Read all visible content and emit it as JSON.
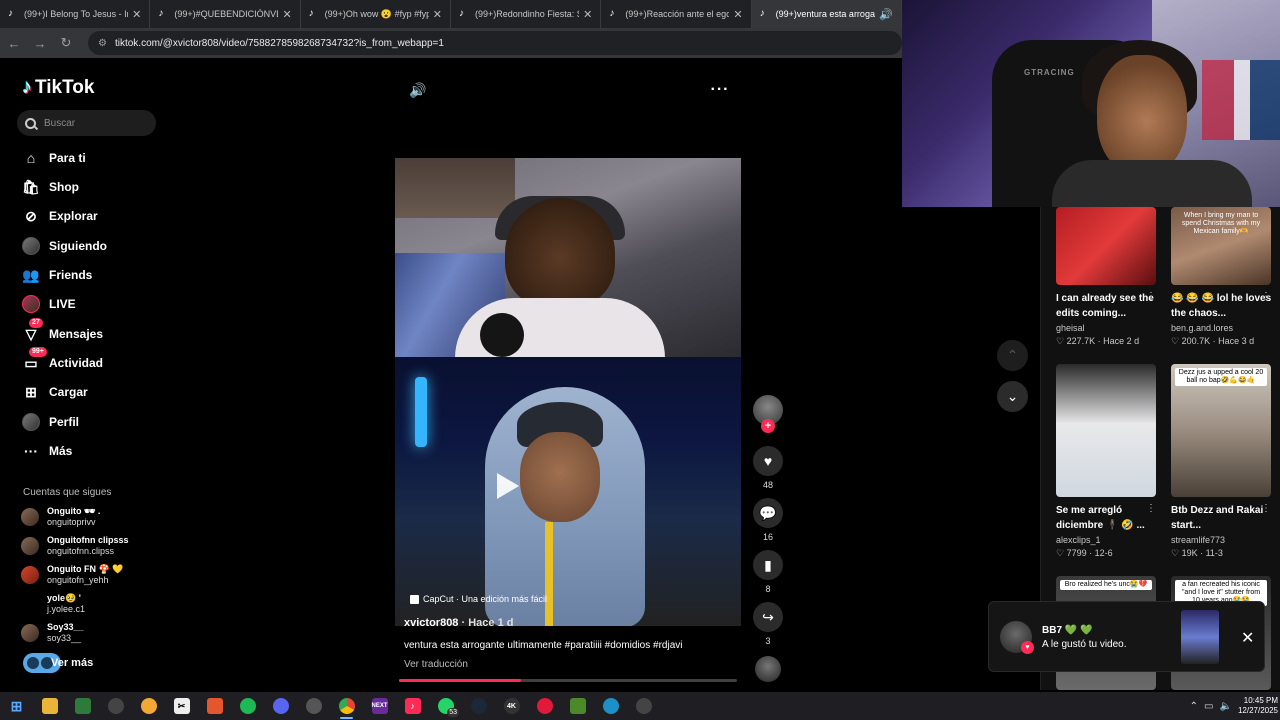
{
  "browser": {
    "tabs": [
      {
        "title": "(99+)I Belong To Jesus - Insp",
        "active": false
      },
      {
        "title": "(99+)#QUEBENDICIÓNVE | ti",
        "active": false
      },
      {
        "title": "(99+)Oh wow 😮 #fyp #fyp",
        "active": false
      },
      {
        "title": "(99+)Redondinho Fiesta: Sie",
        "active": false
      },
      {
        "title": "(99+)Reacción ante el ego en",
        "active": false
      },
      {
        "title": "(99+)ventura esta arroga",
        "active": true
      }
    ],
    "url": "tiktok.com/@xvictor808/video/7588278598268734732?is_from_webapp=1"
  },
  "sidebar": {
    "logo": "TikTok",
    "search_placeholder": "Buscar",
    "nav": [
      {
        "label": "Para ti",
        "icon": "home-icon"
      },
      {
        "label": "Shop",
        "icon": "shop-icon"
      },
      {
        "label": "Explorar",
        "icon": "compass-icon"
      },
      {
        "label": "Siguiendo",
        "icon": "following-avatar-icon"
      },
      {
        "label": "Friends",
        "icon": "friends-icon"
      },
      {
        "label": "LIVE",
        "icon": "live-icon"
      },
      {
        "label": "Mensajes",
        "icon": "messages-icon",
        "badge": "27"
      },
      {
        "label": "Actividad",
        "icon": "activity-icon",
        "badge": "99+"
      },
      {
        "label": "Cargar",
        "icon": "upload-icon"
      },
      {
        "label": "Perfil",
        "icon": "profile-icon"
      },
      {
        "label": "Más",
        "icon": "more-icon"
      }
    ],
    "following_title": "Cuentas que sigues",
    "following": [
      {
        "name": "Onguito 🕶 .",
        "user": "onguitoprivv"
      },
      {
        "name": "Onguitofnn clipsss",
        "user": "onguitofnn.clipss"
      },
      {
        "name": "Onguito FN 🍄 💛",
        "user": "onguitofn_yehh"
      },
      {
        "name": "yole🥹 '",
        "user": "j.yolee.c1"
      },
      {
        "name": "Soy33__",
        "user": "soy33__"
      }
    ],
    "see_more": "Ver más"
  },
  "player": {
    "capcut_label": "CapCut · Una edición más fácil",
    "author": "xvictor808",
    "time_ago": " · Hace 1 d",
    "caption": "ventura esta arrogante ultimamente #paratiiii #domidios #rdjavi",
    "translate": "Ver traducción",
    "progress": 0.36,
    "likes": "48",
    "comments": "16",
    "saves": "8",
    "shares": "3"
  },
  "recommended": [
    {
      "overlay": "",
      "title": "I can already see the edits coming...",
      "user": "gheisal",
      "likes": "227.7K",
      "age": "Hace 2 d"
    },
    {
      "overlay": "When I bring my man to spend Christmas with my Mexican family🫶",
      "title": "😂 😂 😂 lol he loves the chaos...",
      "user": "ben.g.and.lores",
      "likes": "200.7K",
      "age": "Hace 3 d"
    },
    {
      "overlay": "",
      "title": "Se me arregló diciembre 🕴 🤣 ...",
      "user": "alexclips_1",
      "likes": "7799",
      "age": "12-6"
    },
    {
      "overlay": "Dezz jus a upped a cool 20 ball no bap🤣💪😂🤙",
      "title": "Btb Dezz and Rakai start...",
      "user": "streamlife773",
      "likes": "19K",
      "age": "11-3"
    },
    {
      "overlay": "Bro realized he's unc😭💔",
      "title": "",
      "user": "",
      "likes": "",
      "age": ""
    },
    {
      "overlay": "a fan recreated his iconic \"and I love it\" stutter from 10 years ago😭😭",
      "title": "",
      "user": "",
      "likes": "",
      "age": ""
    }
  ],
  "toast": {
    "name": "BB7 💚 💚",
    "message": "A le gustó tu video."
  },
  "webcam": {
    "chair_brand": "GTRACING"
  },
  "taskbar": {
    "badges": {
      "whatsapp": "53"
    },
    "time": "10:45 PM",
    "date": "12/27/2025"
  },
  "colors": {
    "accent": "#fe2c55",
    "background": "#000000",
    "panel": "#111111"
  }
}
